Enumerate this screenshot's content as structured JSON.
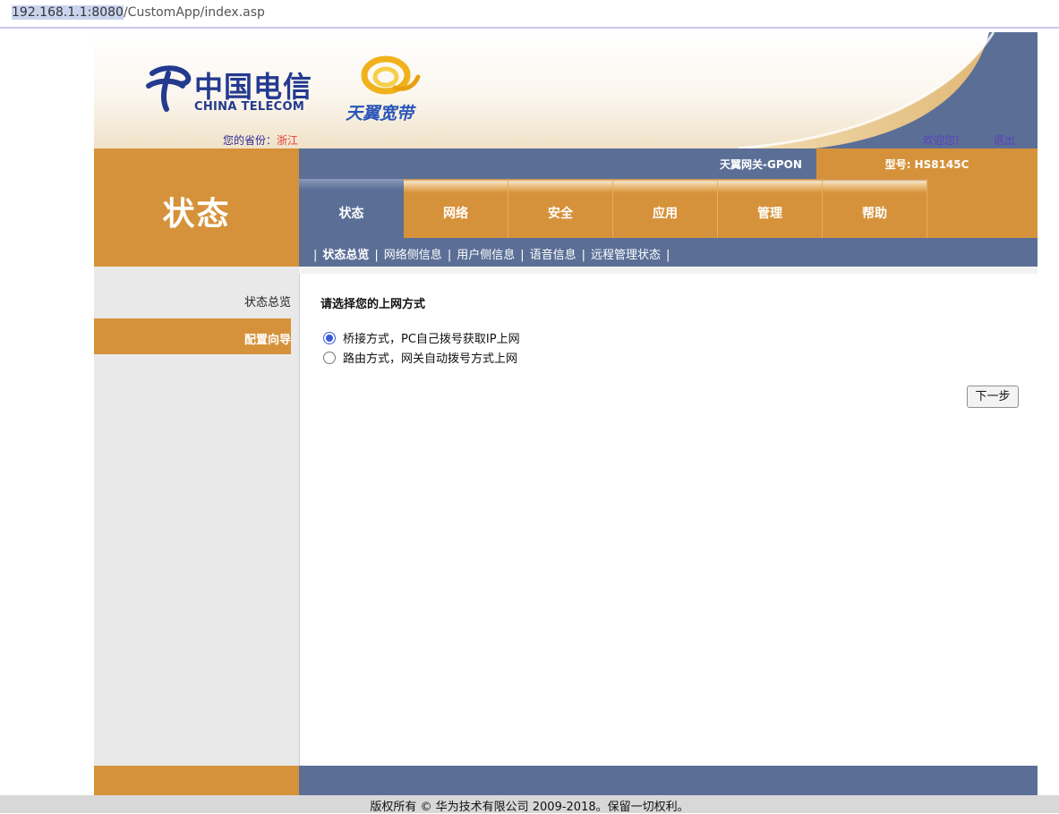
{
  "browser": {
    "url_host": "192.168.1.1:8080",
    "url_path": "/CustomApp/index.asp"
  },
  "header": {
    "brand_cn": "中国电信",
    "brand_en": "CHINA TELECOM",
    "product": "天翼宽带",
    "province_label": "您的省份：",
    "province_value": "浙江",
    "welcome": "欢迎您!",
    "logout": "退出"
  },
  "nav": {
    "section_title": "状态",
    "gateway": "天翼网关-GPON",
    "model": "型号: HS8145C",
    "tabs": [
      {
        "label": "状态",
        "active": true
      },
      {
        "label": "网络"
      },
      {
        "label": "安全"
      },
      {
        "label": "应用"
      },
      {
        "label": "管理"
      },
      {
        "label": "帮助"
      }
    ],
    "subtabs": [
      {
        "label": "状态总览",
        "active": true
      },
      {
        "label": "网络侧信息"
      },
      {
        "label": "用户侧信息"
      },
      {
        "label": "语音信息"
      },
      {
        "label": "远程管理状态"
      }
    ],
    "separator": "|"
  },
  "sidebar": {
    "items": [
      {
        "label": "状态总览"
      },
      {
        "label": "配置向导",
        "active": true
      }
    ]
  },
  "main": {
    "prompt": "请选择您的上网方式",
    "options": [
      {
        "label": "桥接方式，PC自己拨号获取IP上网",
        "selected": true
      },
      {
        "label": "路由方式，网关自动拨号方式上网",
        "selected": false
      }
    ],
    "next_button": "下一步"
  },
  "footer": {
    "copyright": "版权所有 © 华为技术有限公司 2009-2018。保留一切权利。"
  },
  "colors": {
    "orange": "#d6923a",
    "slate": "#5b6f96",
    "brand_blue": "#233a8f"
  }
}
